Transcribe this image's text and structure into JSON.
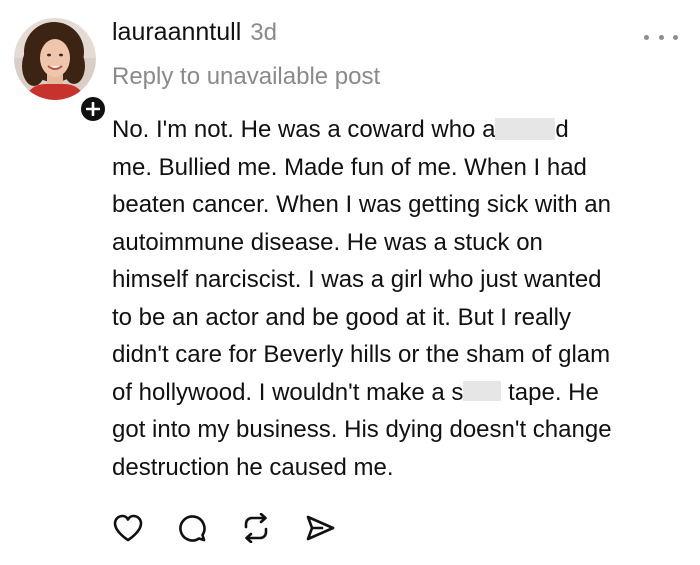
{
  "post": {
    "username": "lauraanntull",
    "time": "3d",
    "reply_context": "Reply to unavailable post",
    "body_lines": [
      {
        "before": "No.  I'm not.  He was a coward who a",
        "after": "d"
      },
      {
        "text": "me.  Bullied me.  Made fun of me.  When I had"
      },
      {
        "text": "beaten cancer.  When I was getting sick with an"
      },
      {
        "text": "autoimmune disease.  He was a stuck on"
      },
      {
        "text": "himself narciscist.  I was a girl who just wanted"
      },
      {
        "text": "to be an actor and be good at it.  But I really"
      },
      {
        "text": "didn't care for Beverly hills or the sham of glam"
      },
      {
        "text": "of hollywood. I wouldn't make a s",
        "after": " tape.  He"
      },
      {
        "text": "got into my business. His dying doesn't change"
      },
      {
        "text": "destruction he caused me."
      }
    ]
  },
  "icons": {
    "follow": "plus-icon",
    "more": "more-options-icon",
    "like": "heart-icon",
    "comment": "comment-icon",
    "repost": "repost-icon",
    "share": "send-icon"
  },
  "colors": {
    "text": "#111111",
    "muted": "#8a8a8a",
    "censor": "#e6e6e6",
    "badge": "#111111"
  }
}
